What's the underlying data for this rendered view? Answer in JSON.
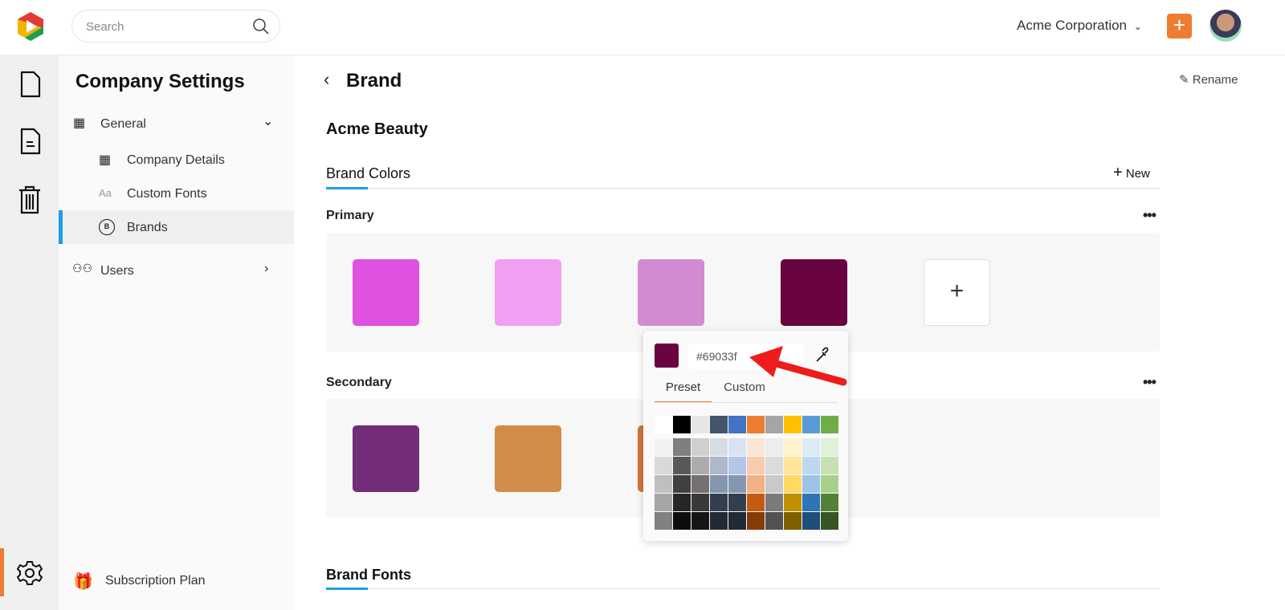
{
  "topbar": {
    "search_placeholder": "Search",
    "org": "Acme Corporation",
    "add_icon": "plus-icon"
  },
  "sidebar": {
    "title": "Company Settings",
    "general": "General",
    "items": [
      "Company Details",
      "Custom Fonts",
      "Brands"
    ],
    "users": "Users",
    "subscription": "Subscription Plan"
  },
  "main": {
    "title": "Brand",
    "rename": "Rename",
    "brand_name": "Acme Beauty",
    "brand_colors": "Brand Colors",
    "new": "New",
    "primary": "Primary",
    "secondary": "Secondary",
    "brand_fonts": "Brand Fonts",
    "primary_colors": [
      "#df52df",
      "#f09ff2",
      "#d28bd0",
      "#69033f"
    ],
    "secondary_colors": [
      "#742d78",
      "#d08c48",
      "#d4733a"
    ]
  },
  "picker": {
    "hex": "#69033f",
    "tabs": [
      "Preset",
      "Custom"
    ],
    "active_tab": "Preset",
    "theme_colors": [
      "#ffffff",
      "#000000",
      "#e7e6e6",
      "#44546a",
      "#4472c4",
      "#ed7d31",
      "#a5a5a5",
      "#ffc000",
      "#5b9bd5",
      "#70ad47"
    ],
    "shades": [
      [
        "#f2f2f2",
        "#d9d9d9",
        "#bfbfbf",
        "#a6a6a6",
        "#808080"
      ],
      [
        "#7f7f7f",
        "#595959",
        "#404040",
        "#262626",
        "#0d0d0d"
      ],
      [
        "#d0cece",
        "#aeabab",
        "#757171",
        "#3a3838",
        "#171616"
      ],
      [
        "#d6dce4",
        "#adb9ca",
        "#8496b0",
        "#333f4f",
        "#222a35"
      ],
      [
        "#d9e2f3",
        "#b4c6e7",
        "#8497b0",
        "#323f4f",
        "#222a35"
      ],
      [
        "#fbe5d5",
        "#f7cbac",
        "#f4b183",
        "#c55a11",
        "#843c0b"
      ],
      [
        "#ededed",
        "#dbdbdb",
        "#c9c9c9",
        "#7b7b7b",
        "#525252"
      ],
      [
        "#fff2cc",
        "#ffe599",
        "#ffd966",
        "#bf9000",
        "#7f6000"
      ],
      [
        "#deebf6",
        "#bdd7ee",
        "#9dc3e6",
        "#2e75b5",
        "#1f4e79"
      ],
      [
        "#e2efd9",
        "#c5e0b3",
        "#a8d08d",
        "#538135",
        "#375623"
      ]
    ]
  },
  "colors": {
    "accent_orange": "#ee7d31",
    "active_blue": "#1a9ee8",
    "annotation_arrow": "#ee1c1c"
  }
}
